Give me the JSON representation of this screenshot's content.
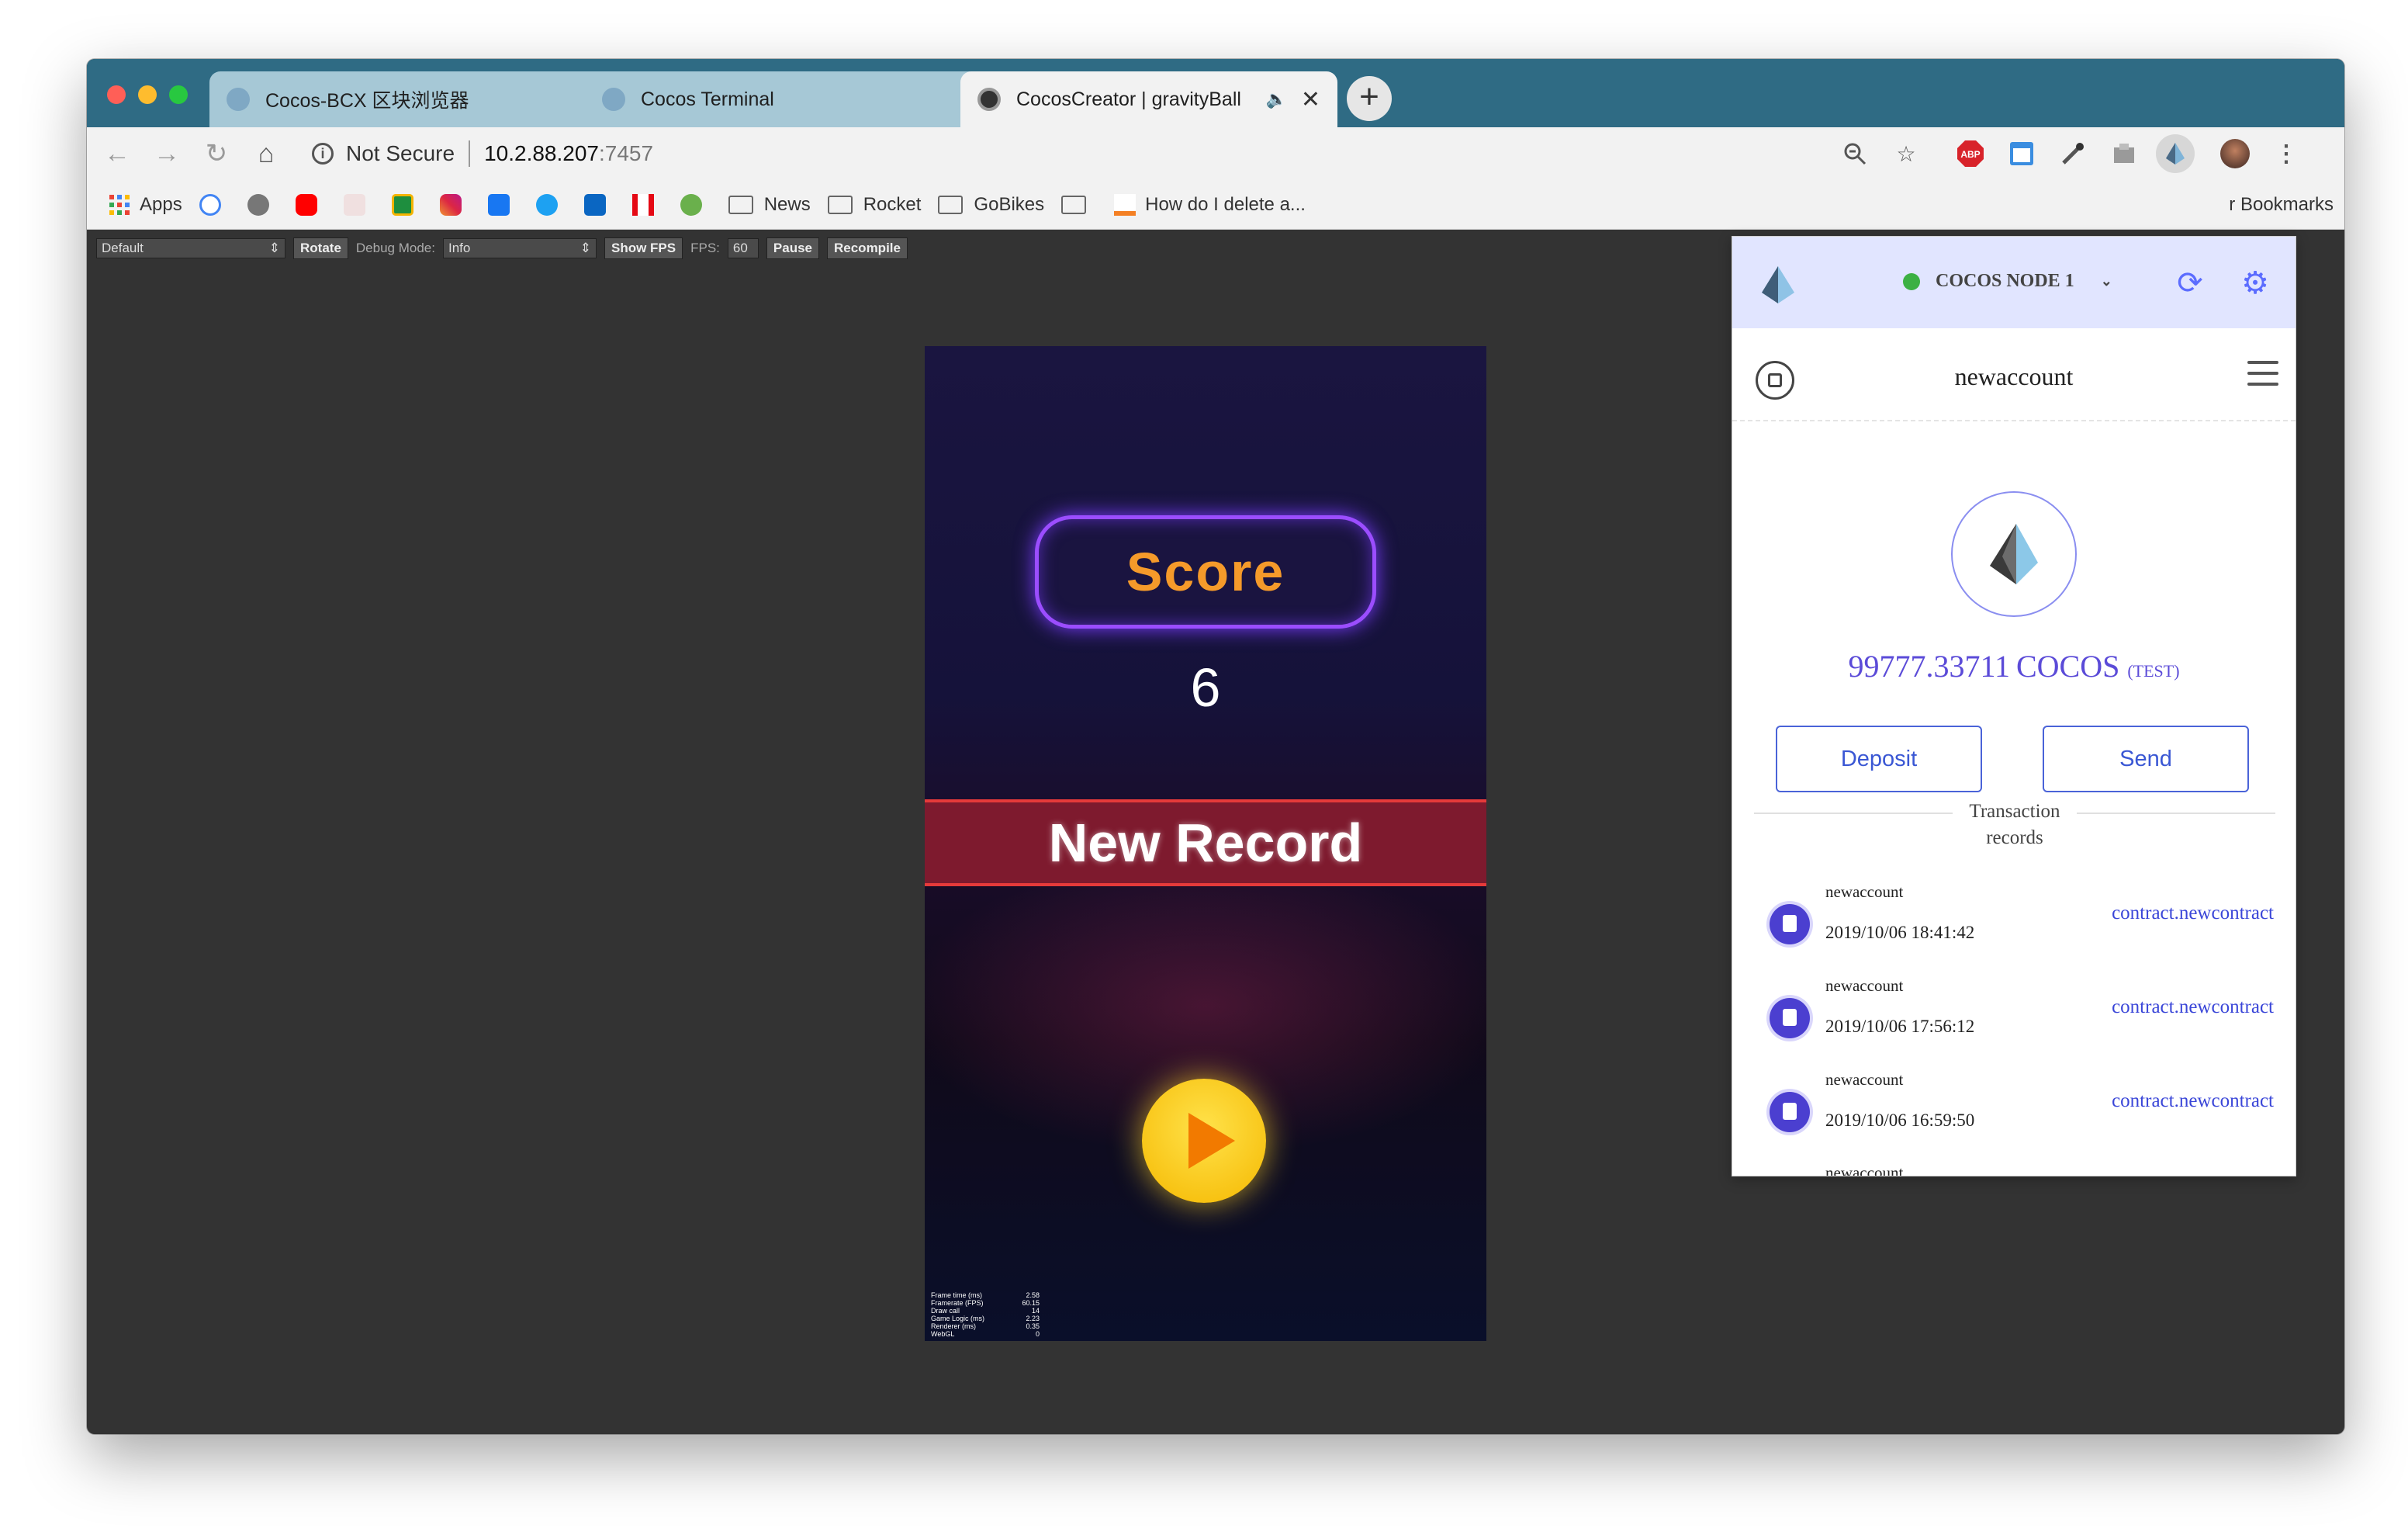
{
  "browser": {
    "tabs": [
      {
        "title": "Cocos-BCX 区块浏览器",
        "close": "✕"
      },
      {
        "title": "Cocos Terminal",
        "close": "✕"
      },
      {
        "title": "CocosCreator | gravityBall",
        "close": "✕",
        "audio": "🔈"
      }
    ],
    "new_tab": "+",
    "security": "Not Secure",
    "url_host": "10.2.88.207",
    "url_port": ":7457",
    "bookmarks": [
      {
        "label": "Apps",
        "color": "#4285f4"
      },
      {
        "label": "",
        "color": "#ea4335"
      },
      {
        "label": "",
        "color": "#777777"
      },
      {
        "label": "",
        "color": "#ff0000"
      },
      {
        "label": "",
        "color": "#e0e0e0"
      },
      {
        "label": "",
        "color": "#1e8e3e"
      },
      {
        "label": "",
        "color": "#c13584"
      },
      {
        "label": "",
        "color": "#1877f2"
      },
      {
        "label": "",
        "color": "#1da1f2"
      },
      {
        "label": "",
        "color": "#0a66c2"
      },
      {
        "label": "",
        "color": "#e50914"
      },
      {
        "label": "",
        "color": "#6ab04c"
      }
    ],
    "bookmark_folders": [
      "News",
      "Rocket",
      "GoBikes",
      ""
    ],
    "bookmark_link": "How do I delete a...",
    "other_bookmarks": "r Bookmarks"
  },
  "debug": {
    "preset": "Default",
    "rotate": "Rotate",
    "debug_mode_label": "Debug Mode:",
    "debug_mode_value": "Info",
    "show_fps": "Show FPS",
    "fps_label": "FPS:",
    "fps_value": "60",
    "pause": "Pause",
    "recompile": "Recompile"
  },
  "game": {
    "score_label": "Score",
    "score_value": "6",
    "new_record": "New Record",
    "stats": [
      {
        "k": "Frame time (ms)",
        "v": "2.58"
      },
      {
        "k": "Framerate (FPS)",
        "v": "60.15"
      },
      {
        "k": "Draw call",
        "v": "14"
      },
      {
        "k": "Game Logic (ms)",
        "v": "2.23"
      },
      {
        "k": "Renderer (ms)",
        "v": "0.35"
      },
      {
        "k": "WebGL",
        "v": "0"
      }
    ]
  },
  "wallet": {
    "node": "COCOS NODE 1",
    "account": "newaccount",
    "balance": "99777.33711",
    "currency": "COCOS",
    "network": "(TEST)",
    "deposit": "Deposit",
    "send": "Send",
    "tx_header": "Transaction records",
    "transactions": [
      {
        "account": "newaccount",
        "time": "2019/10/06 18:41:42",
        "contract": "contract.newcontract"
      },
      {
        "account": "newaccount",
        "time": "2019/10/06 17:56:12",
        "contract": "contract.newcontract"
      },
      {
        "account": "newaccount",
        "time": "2019/10/06 16:59:50",
        "contract": "contract.newcontract"
      },
      {
        "account": "newaccount",
        "time": "",
        "contract": ""
      }
    ],
    "accent": "#5b6cff"
  }
}
